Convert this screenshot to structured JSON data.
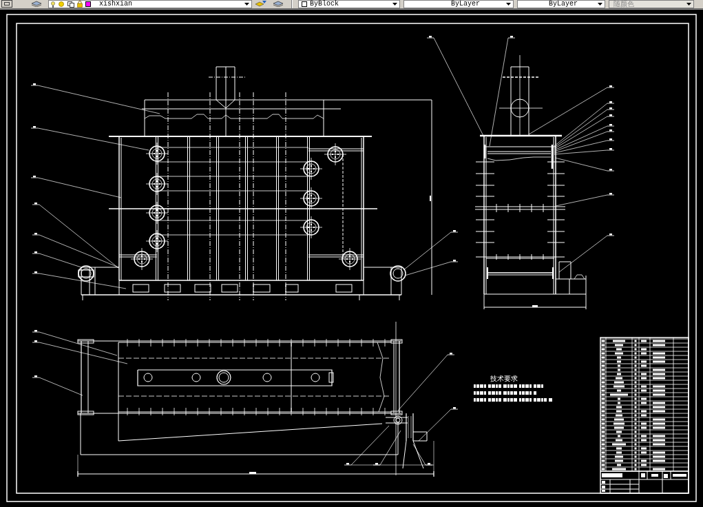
{
  "toolbar": {
    "layer_dropdown": {
      "text": "xishxian"
    },
    "property_dropdowns": [
      {
        "kind": "color",
        "text": "ByBlock",
        "disabled": false
      },
      {
        "kind": "linetype",
        "text": "ByLayer",
        "disabled": false
      },
      {
        "kind": "lineweight",
        "text": "ByLayer",
        "disabled": false
      },
      {
        "kind": "plotstyle",
        "text": "随颜色",
        "disabled": true
      }
    ]
  },
  "drawing": {
    "notes": {
      "title": "技术要求"
    }
  }
}
